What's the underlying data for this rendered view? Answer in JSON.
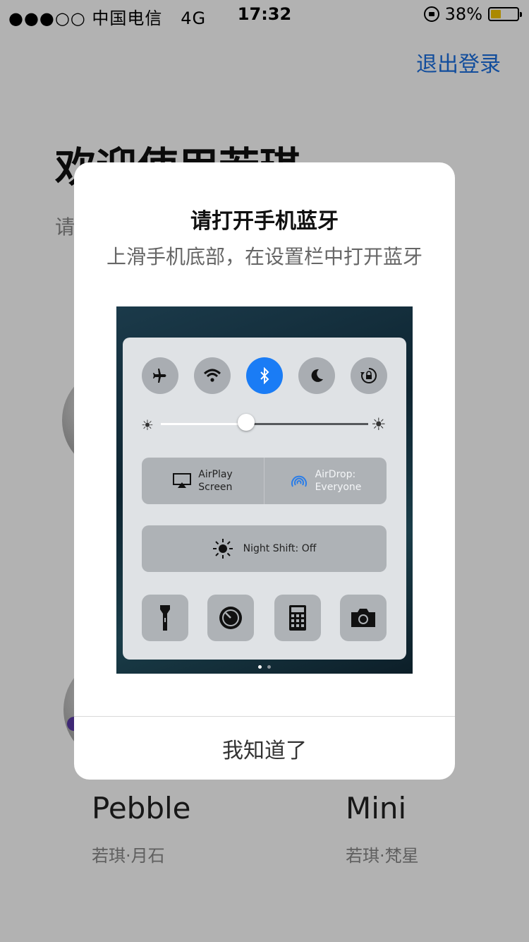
{
  "status_bar": {
    "carrier": "●●●○○ 中国电信",
    "network": "4G",
    "time": "17:32",
    "battery": "38%",
    "battery_level": 0.38
  },
  "page": {
    "logout": "退出登录",
    "title": "欢迎使用若琪",
    "subtitle": "请",
    "devices": [
      {
        "name": "Pebble",
        "sub": "若琪·月石"
      },
      {
        "name": "Mini",
        "sub": "若琪·梵星"
      }
    ]
  },
  "modal": {
    "title": "请打开手机蓝牙",
    "description": "上滑手机底部，在设置栏中打开蓝牙",
    "button": "我知道了"
  },
  "control_center": {
    "toggles": [
      "airplane-icon",
      "wifi-icon",
      "bluetooth-icon",
      "moon-icon",
      "rotation-lock-icon"
    ],
    "active_toggle": "bluetooth-icon",
    "brightness": 0.41,
    "airplay": {
      "line1": "AirPlay",
      "line2": "Screen"
    },
    "airdrop": {
      "line1": "AirDrop:",
      "line2": "Everyone"
    },
    "night_shift": "Night Shift: Off",
    "shortcuts": [
      "flashlight-icon",
      "timer-icon",
      "calculator-icon",
      "camera-icon"
    ],
    "page_dots": 2,
    "current_page": 1
  },
  "colors": {
    "accent": "#1a6fe0",
    "bluetooth_active": "#1a7cf5",
    "battery_fill": "#f5c400"
  }
}
